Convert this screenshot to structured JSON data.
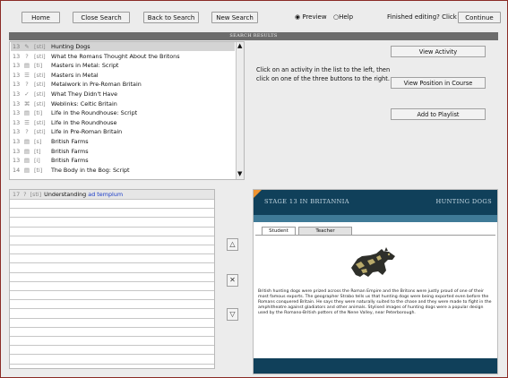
{
  "toolbar": {
    "home": "Home",
    "close_search": "Close Search",
    "back_to_search": "Back to Search",
    "new_search": "New Search",
    "preview_label": "Preview",
    "help_label": "Help",
    "finished_text": "Finished editing? Click",
    "continue": "Continue"
  },
  "results_header": "SEARCH RESULTS",
  "results": [
    {
      "num": "13",
      "icon": "✎",
      "tag": "[sti]",
      "title": "Hunting Dogs"
    },
    {
      "num": "13",
      "icon": "?",
      "tag": "[sti]",
      "title": "What the Romans Thought About the Britons"
    },
    {
      "num": "13",
      "icon": "▤",
      "tag": "[ti]",
      "title": "Masters in Metal: Script"
    },
    {
      "num": "13",
      "icon": "☰",
      "tag": "[sti]",
      "title": "Masters in Metal"
    },
    {
      "num": "13",
      "icon": "?",
      "tag": "[sti]",
      "title": "Metalwork in Pre-Roman Britain"
    },
    {
      "num": "13",
      "icon": "✓",
      "tag": "[sti]",
      "title": "What They Didn't Have"
    },
    {
      "num": "13",
      "icon": "⌘",
      "tag": "[sti]",
      "title": "Weblinks: Celtic Britain"
    },
    {
      "num": "13",
      "icon": "▤",
      "tag": "[ti]",
      "title": "Life in the Roundhouse: Script"
    },
    {
      "num": "13",
      "icon": "☰",
      "tag": "[sti]",
      "title": "Life in the Roundhouse"
    },
    {
      "num": "13",
      "icon": "?",
      "tag": "[sti]",
      "title": "Life in Pre-Roman Britain"
    },
    {
      "num": "13",
      "icon": "▤",
      "tag": "[s]",
      "title": "British Farms"
    },
    {
      "num": "13",
      "icon": "▤",
      "tag": "[t]",
      "title": "British Farms"
    },
    {
      "num": "13",
      "icon": "▤",
      "tag": "[i]",
      "title": "British Farms"
    },
    {
      "num": "14",
      "icon": "▤",
      "tag": "[ti]",
      "title": "The Body in the Bog: Script"
    }
  ],
  "instructions": "Click on an activity in the list to the left, then click on one of the three buttons to the right.",
  "actions": {
    "view_activity": "View Activity",
    "view_position": "View Position in Course",
    "add_to_playlist": "Add to Playlist"
  },
  "playlist": {
    "first_num": "17",
    "first_icon": "?",
    "first_tag": "[sti]",
    "first_title": "Understanding",
    "first_link": "ad templum"
  },
  "side_buttons": {
    "up": "△",
    "remove": "✕",
    "down": "▽"
  },
  "preview": {
    "stage": "STAGE 13 IN BRITANNIA",
    "title": "HUNTING DOGS",
    "tab_student": "Student",
    "tab_teacher": "Teacher",
    "body": "British hunting dogs were prized across the Roman Empire and the Britons were justly proud of one of their most famous exports. The geographer Strabo tells us that hunting dogs were being exported even before the Romans conquered Britain. He says they were naturally suited to the chase and they were made to fight in the amphitheatre against gladiators and other animals. Stylised images of hunting dogs were a popular design used by the Romano-British potters of the Nene Valley, near Peterborough."
  },
  "colors": {
    "accent_header": "#10405a",
    "corner": "#ee9330",
    "link": "#1a3cc8"
  }
}
